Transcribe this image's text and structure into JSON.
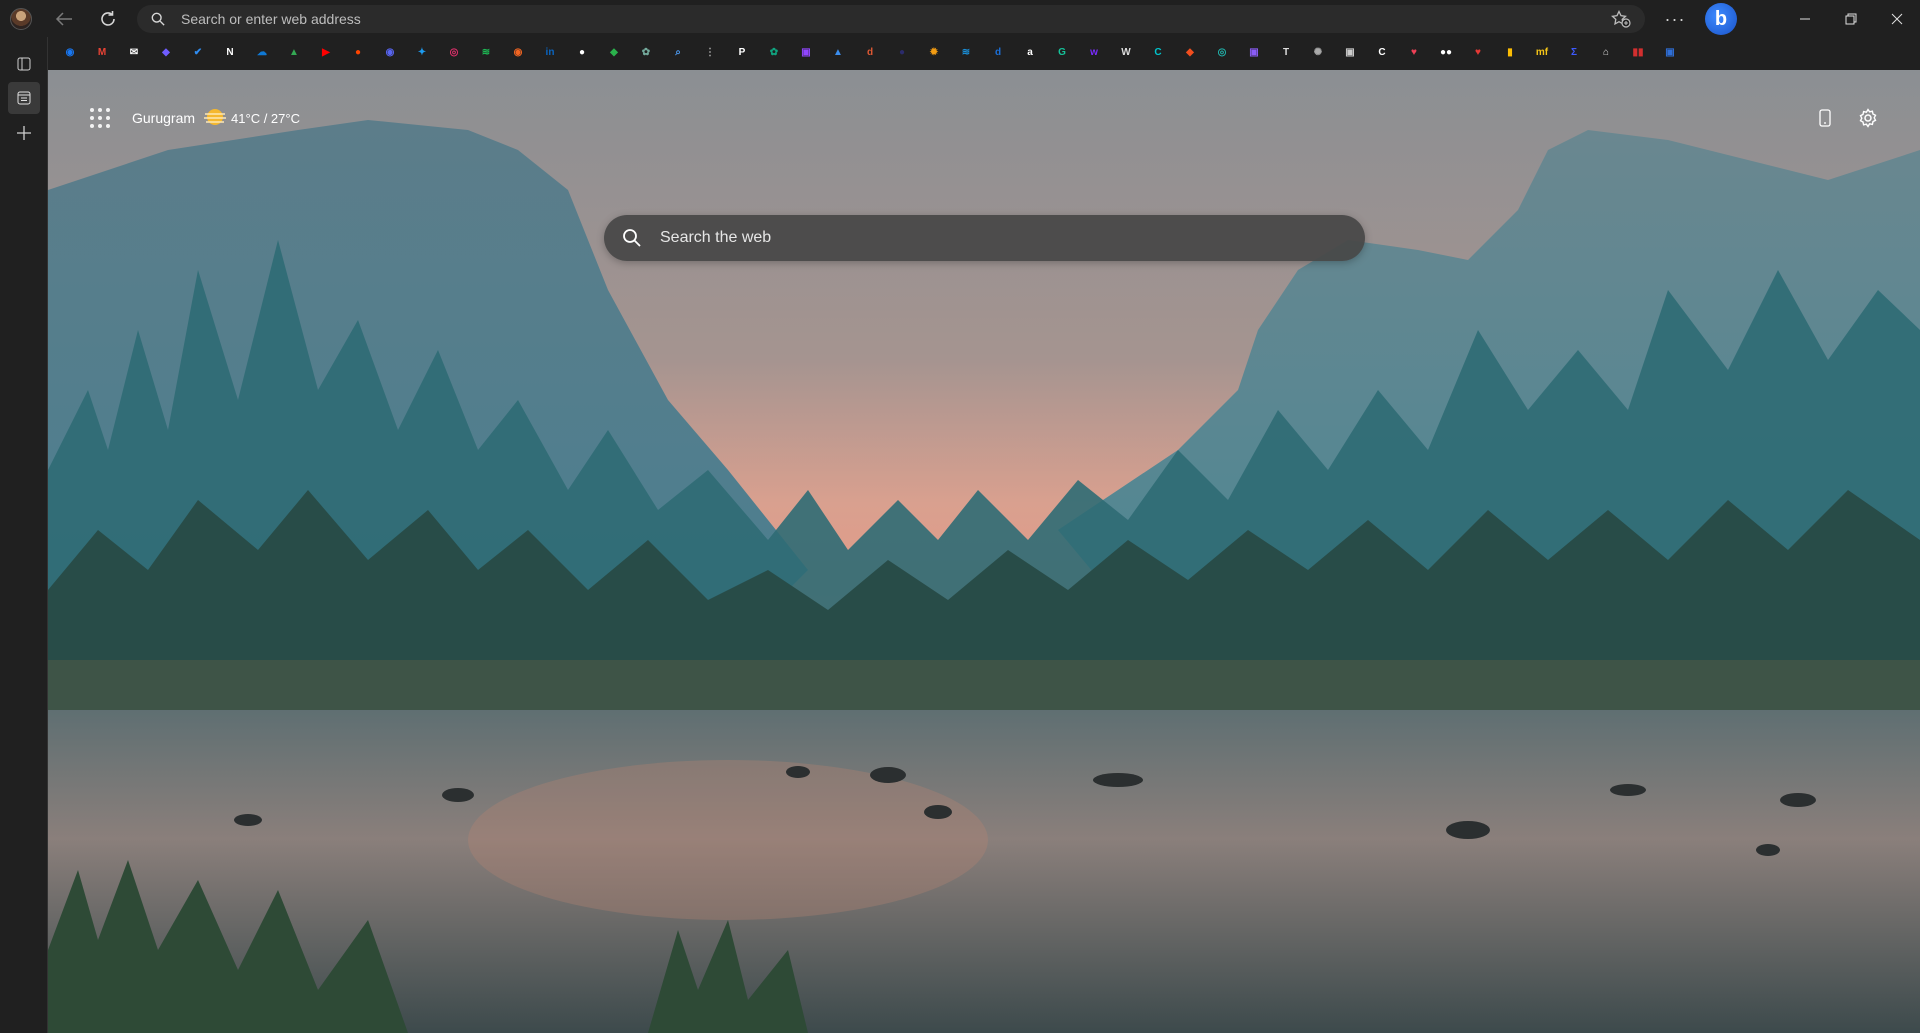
{
  "browser": {
    "address_placeholder": "Search or enter web address",
    "more_label": "···"
  },
  "favorites": [
    {
      "name": "messenger",
      "color": "#1877f2",
      "glyph": "◉"
    },
    {
      "name": "gmail",
      "color": "#ea4335",
      "glyph": "M"
    },
    {
      "name": "mail",
      "color": "#ffffff",
      "glyph": "✉"
    },
    {
      "name": "pcloud",
      "color": "#6f5cff",
      "glyph": "◆"
    },
    {
      "name": "todo",
      "color": "#2f8cf0",
      "glyph": "✔"
    },
    {
      "name": "notion",
      "color": "#ffffff",
      "glyph": "N"
    },
    {
      "name": "onedrive",
      "color": "#0f78d4",
      "glyph": "☁"
    },
    {
      "name": "google-drive",
      "color": "#34a853",
      "glyph": "▲"
    },
    {
      "name": "youtube",
      "color": "#ff0000",
      "glyph": "▶"
    },
    {
      "name": "reddit",
      "color": "#ff4500",
      "glyph": "●"
    },
    {
      "name": "discord",
      "color": "#5865f2",
      "glyph": "◉"
    },
    {
      "name": "twitter",
      "color": "#1d9bf0",
      "glyph": "✦"
    },
    {
      "name": "instagram",
      "color": "#e1306c",
      "glyph": "◎"
    },
    {
      "name": "spotify",
      "color": "#1db954",
      "glyph": "≋"
    },
    {
      "name": "rss",
      "color": "#f26522",
      "glyph": "◉"
    },
    {
      "name": "linkedin",
      "color": "#0a66c2",
      "glyph": "in"
    },
    {
      "name": "github",
      "color": "#ffffff",
      "glyph": "●"
    },
    {
      "name": "feedly",
      "color": "#2bb24c",
      "glyph": "◆"
    },
    {
      "name": "chatgpt",
      "color": "#74aa9c",
      "glyph": "✿"
    },
    {
      "name": "search",
      "color": "#4d9bf2",
      "glyph": "⌕"
    },
    {
      "name": "grid",
      "color": "#aaaaaa",
      "glyph": "⋮"
    },
    {
      "name": "p-app",
      "color": "#ffffff",
      "glyph": "P"
    },
    {
      "name": "openai",
      "color": "#10a37f",
      "glyph": "✿"
    },
    {
      "name": "twitch",
      "color": "#9146ff",
      "glyph": "▣"
    },
    {
      "name": "photos",
      "color": "#3b8ded",
      "glyph": "▲"
    },
    {
      "name": "duckduckgo",
      "color": "#de5833",
      "glyph": "d"
    },
    {
      "name": "dark-app",
      "color": "#2b2b6b",
      "glyph": "●"
    },
    {
      "name": "gear-orange",
      "color": "#f39c12",
      "glyph": "✹"
    },
    {
      "name": "msn",
      "color": "#1a8fd8",
      "glyph": "≋"
    },
    {
      "name": "dictionary",
      "color": "#1b6fd8",
      "glyph": "d"
    },
    {
      "name": "amazon",
      "color": "#ffffff",
      "glyph": "a"
    },
    {
      "name": "grammarly",
      "color": "#15c39a",
      "glyph": "G"
    },
    {
      "name": "wattpad",
      "color": "#7a2bff",
      "glyph": "w"
    },
    {
      "name": "wikipedia",
      "color": "#dddddd",
      "glyph": "W"
    },
    {
      "name": "canva",
      "color": "#00c4cc",
      "glyph": "C"
    },
    {
      "name": "figma",
      "color": "#f24e1e",
      "glyph": "◆"
    },
    {
      "name": "perplexity",
      "color": "#20b2aa",
      "glyph": "◎"
    },
    {
      "name": "clapper",
      "color": "#8a5cf6",
      "glyph": "▣"
    },
    {
      "name": "typewriter",
      "color": "#dddddd",
      "glyph": "T"
    },
    {
      "name": "aperture",
      "color": "#aaaaaa",
      "glyph": "✺"
    },
    {
      "name": "chip",
      "color": "#cccccc",
      "glyph": "▣"
    },
    {
      "name": "c-app",
      "color": "#ffffff",
      "glyph": "C"
    },
    {
      "name": "pocket",
      "color": "#ef4056",
      "glyph": "♥"
    },
    {
      "name": "medium",
      "color": "#ffffff",
      "glyph": "●●"
    },
    {
      "name": "heart-app",
      "color": "#e53935",
      "glyph": "♥"
    },
    {
      "name": "keep",
      "color": "#fbbc04",
      "glyph": "▮"
    },
    {
      "name": "mf-app",
      "color": "#f5c518",
      "glyph": "mf"
    },
    {
      "name": "bracket-app",
      "color": "#3d5afe",
      "glyph": "Σ"
    },
    {
      "name": "bank",
      "color": "#dddddd",
      "glyph": "⌂"
    },
    {
      "name": "books",
      "color": "#d32f2f",
      "glyph": "▮▮"
    },
    {
      "name": "profile-app",
      "color": "#2f6fd8",
      "glyph": "▣"
    }
  ],
  "newtab": {
    "weather_city": "Gurugram",
    "weather_temps": "41°C / 27°C",
    "search_placeholder": "Search the web"
  }
}
